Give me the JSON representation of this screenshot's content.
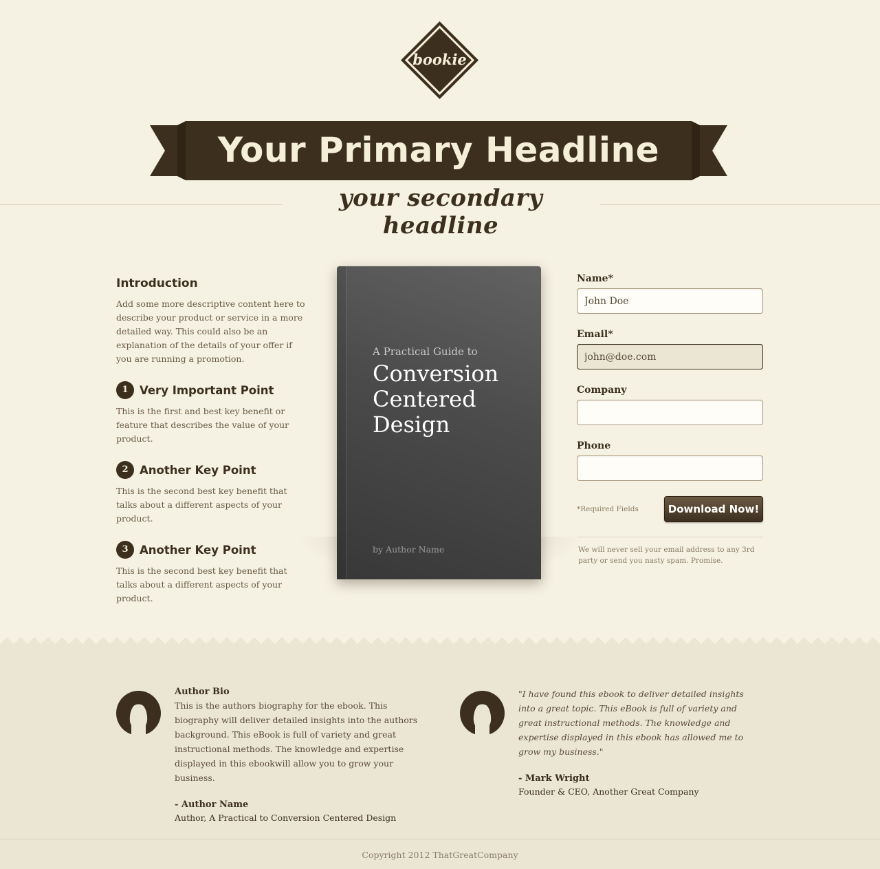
{
  "brand": {
    "logo_text": "bookie",
    "primary_color": "#3d2f1e",
    "background_color": "#f5f1e3",
    "cream_color": "#f5efd8"
  },
  "header": {
    "primary_headline": "Your Primary Headline",
    "secondary_headline": "your secondary headline"
  },
  "intro": {
    "title": "Introduction",
    "text": "Add some more descriptive content here to describe your product or service in a more detailed way. This could also be an explanation of the details of your offer if you are running a promotion."
  },
  "points": [
    {
      "number": "1",
      "title": "Very Important Point",
      "text": "This is the first and best key benefit or feature that describes the value of your product."
    },
    {
      "number": "2",
      "title": "Another Key Point",
      "text": "This is the second best key benefit that talks about a different aspects of your product."
    },
    {
      "number": "3",
      "title": "Another Key Point",
      "text": "This is the second best key benefit that talks about a different aspects of your product."
    }
  ],
  "book": {
    "pre_title": "A Practical Guide to",
    "title_lines": [
      "Conversion",
      "Centered",
      "Design"
    ],
    "author": "by Author Name"
  },
  "form": {
    "fields": [
      {
        "label": "Name*",
        "value": "John Doe",
        "placeholder": ""
      },
      {
        "label": "Email*",
        "value": "john@doe.com",
        "placeholder": ""
      },
      {
        "label": "Company",
        "value": "",
        "placeholder": ""
      },
      {
        "label": "Phone",
        "value": "",
        "placeholder": ""
      }
    ],
    "required_note": "*Required Fields",
    "submit_label": "Download Now!",
    "privacy_note": "We will never sell your email address to any 3rd party or send you nasty spam. Promise."
  },
  "testimonials": [
    {
      "heading": "Author Bio",
      "text": "This is the authors biography for the ebook. This biography will deliver detailed insights into the authors background. This eBook is full of variety and great instructional methods. The knowledge and expertise displayed in this ebookwill allow you to grow your business.",
      "name": "- Author Name",
      "role": "Author, A Practical to Conversion Centered Design"
    },
    {
      "heading": "",
      "text": "\"I have found this ebook to deliver detailed insights into a great topic. This eBook is full of variety and great instructional methods. The knowledge and expertise displayed in this ebook has allowed me to grow my business.\"",
      "name": "- Mark Wright",
      "role": "Founder & CEO, Another Great Company"
    }
  ],
  "footer": {
    "copyright": "Copyright 2012 ThatGreatCompany"
  }
}
